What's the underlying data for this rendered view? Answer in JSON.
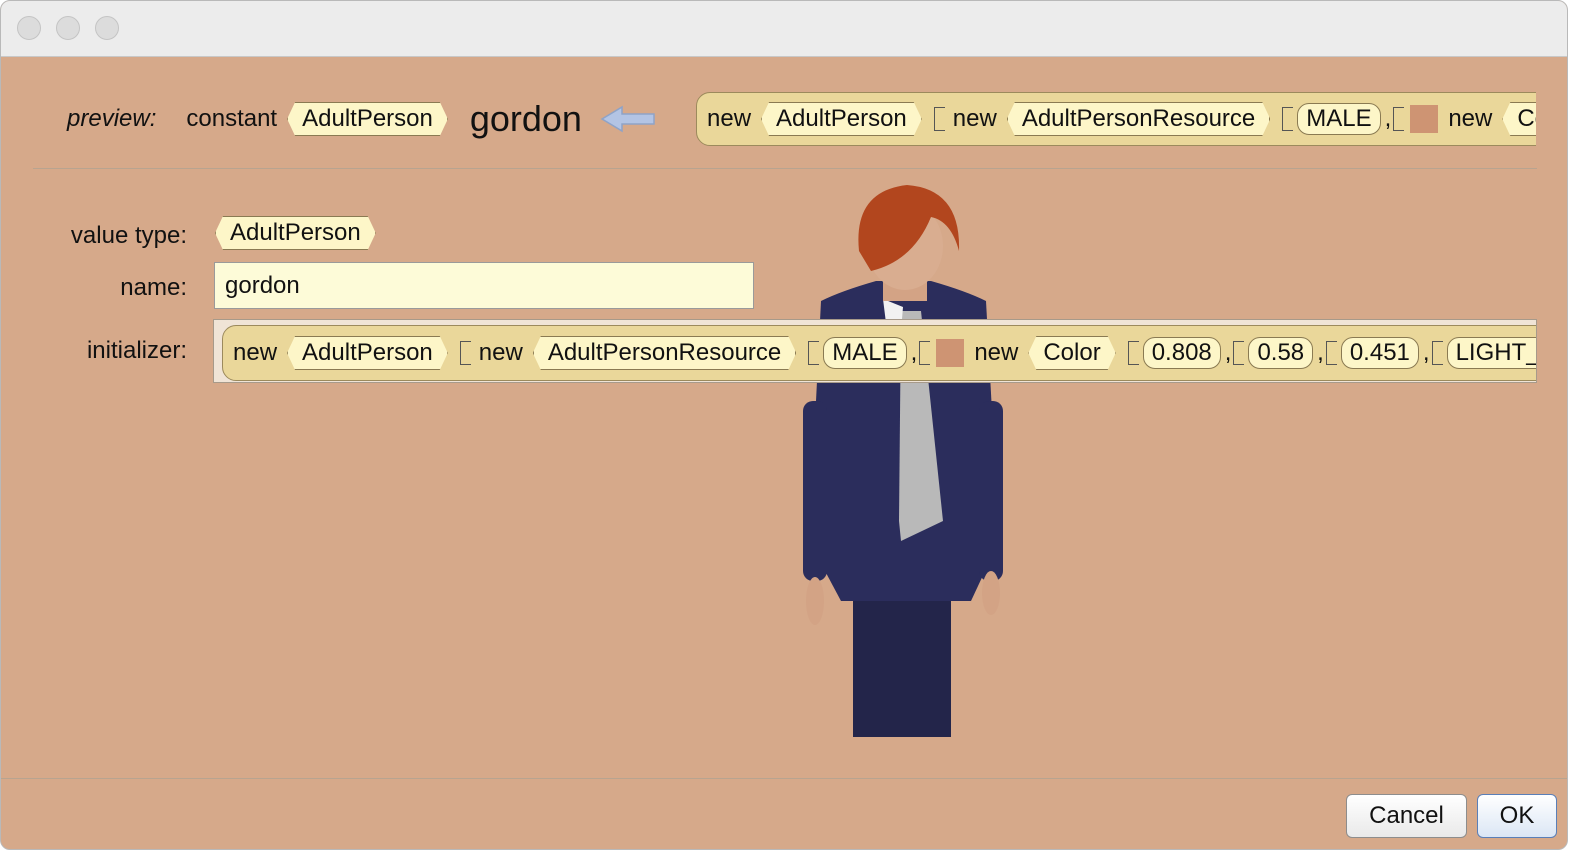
{
  "window": {
    "title": ""
  },
  "preview": {
    "label": "preview:",
    "constant_kw": "constant",
    "type": "AdultPerson",
    "name": "gordon",
    "arrow_icon": "left-arrow-icon",
    "expr": {
      "new1": "new",
      "type1": "AdultPerson",
      "new2": "new",
      "type2": "AdultPersonResource",
      "gender": "MALE",
      "comma": ",",
      "new3": "new",
      "type3": "Colo"
    }
  },
  "form": {
    "value_type_label": "value type:",
    "value_type": "AdultPerson",
    "name_label": "name:",
    "name_value": "gordon",
    "initializer_label": "initializer:",
    "initializer": {
      "new1": "new",
      "type1": "AdultPerson",
      "new2": "new",
      "type2": "AdultPersonResource",
      "gender": "MALE",
      "comma": ",",
      "new3": "new",
      "type3": "Color",
      "r": "0.808",
      "g": "0.58",
      "b": "0.451",
      "eyes": "LIGHT_BL"
    },
    "color_swatch": "#ce9473"
  },
  "buttons": {
    "cancel": "Cancel",
    "ok": "OK"
  }
}
